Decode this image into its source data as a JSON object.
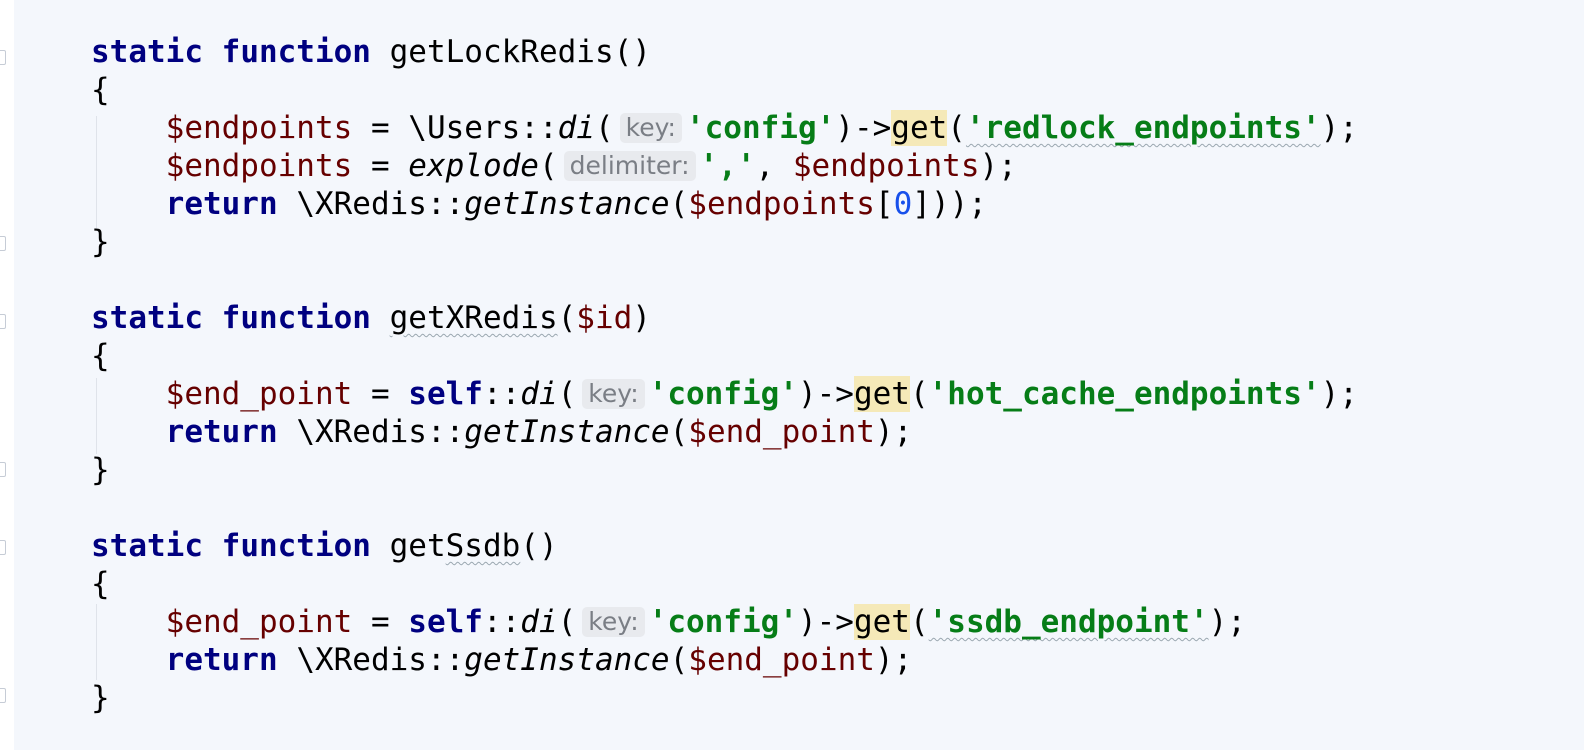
{
  "code": {
    "static_kw": "static",
    "function_kw": "function",
    "return_kw": "return",
    "self_kw": "self",
    "open_brace": "{",
    "close_brace": "}",
    "blocks": [
      {
        "name": "getLockRedis",
        "params": "()",
        "param_var": "",
        "lines": [
          {
            "var": "$endpoints",
            "op": " = ",
            "callee_prefix": "\\Users::",
            "callee": "di",
            "hint": "key:",
            "arg": "'config'",
            "chain_get": "get",
            "chain_arg": "'redlock_endpoints'",
            "tail": ");"
          },
          {
            "var": "$endpoints",
            "op": " = ",
            "callee": "explode",
            "hint": "delimiter:",
            "arg": "','",
            "sep": ", ",
            "arg2": "$endpoints",
            "tail": ");"
          },
          {
            "prefix": "\\XRedis::",
            "callee": "getInstance",
            "arg": "$endpoints",
            "index_open": "[",
            "index": "0",
            "index_close": "]",
            "tail": ");"
          }
        ]
      },
      {
        "name": "getXRedis",
        "params_open": "(",
        "param_var": "$id",
        "params_close": ")",
        "lines": [
          {
            "var": "$end_point",
            "op": " = ",
            "callee_sep": "::",
            "callee": "di",
            "hint": "key:",
            "arg": "'config'",
            "chain_get": "get",
            "chain_arg": "'hot_cache_endpoints'",
            "tail": ");"
          },
          {
            "prefix": "\\XRedis::",
            "callee": "getInstance",
            "arg": "$end_point",
            "tail": ");"
          }
        ]
      },
      {
        "name_pre": "get",
        "name_wavy": "Ssdb",
        "params": "()",
        "lines": [
          {
            "var": "$end_point",
            "op": " = ",
            "callee_sep": "::",
            "callee": "di",
            "hint": "key:",
            "arg": "'config'",
            "chain_get": "get",
            "chain_arg": "'ssdb_endpoint'",
            "tail": ");"
          },
          {
            "prefix": "\\XRedis::",
            "callee": "getInstance",
            "arg": "$end_point",
            "tail": ");"
          }
        ]
      }
    ]
  },
  "colors": {
    "background": "#f4f7fc",
    "keyword": "#000080",
    "variable": "#660000",
    "string": "#067d17",
    "number": "#1750eb",
    "highlight": "#f5e9b8",
    "hint_bg": "#e8eaee"
  }
}
